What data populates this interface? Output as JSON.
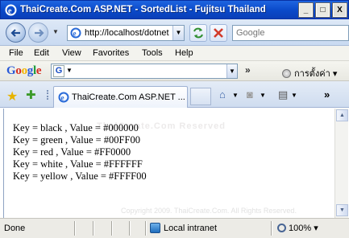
{
  "window": {
    "title": "ThaiCreate.Com ASP.NET - SortedList - Fujitsu Thailand",
    "minimize_glyph": "_",
    "maximize_glyph": "□",
    "close_glyph": "X"
  },
  "navigation": {
    "address": "http://localhost/dotnet",
    "search_placeholder": "Google"
  },
  "menu": {
    "items": [
      "File",
      "Edit",
      "View",
      "Favorites",
      "Tools",
      "Help"
    ]
  },
  "google_toolbar": {
    "logo_letters": [
      "G",
      "o",
      "o",
      "g",
      "l",
      "e"
    ],
    "logo_colors": [
      "#2a5ad7",
      "#d62d20",
      "#f4b400",
      "#2a5ad7",
      "#1c9a3b",
      "#d62d20"
    ],
    "engine_icon_letter": "G",
    "more_glyph": "»",
    "settings_label": "การตั้งค่า"
  },
  "tabs": {
    "active_label": "ThaiCreate.Com ASP.NET ..."
  },
  "page": {
    "watermark_title": "ThaiCreate.Com Reserved",
    "watermark_copyright": "Copyright 2009. ThaiCreate.Com. All Rights Reserved.",
    "lines": [
      "Key = black , Value = #000000",
      "Key = green , Value = #00FF00",
      "Key = red , Value = #FF0000",
      "Key = white , Value = #FFFFFF",
      "Key = yellow , Value = #FFFF00"
    ]
  },
  "status": {
    "text": "Done",
    "zone": "Local intranet",
    "zoom": "100%"
  },
  "colors": {
    "titlebar": "#0a49c9",
    "stop_red": "#d23b2b",
    "refresh_green": "#2f8f2f"
  },
  "icons": [
    "ie-logo-icon",
    "back-arrow-icon",
    "forward-arrow-icon",
    "refresh-icon",
    "stop-icon",
    "favorites-star-icon",
    "add-favorite-icon",
    "home-icon",
    "rss-icon",
    "print-icon",
    "globe-icon",
    "zoom-icon"
  ]
}
